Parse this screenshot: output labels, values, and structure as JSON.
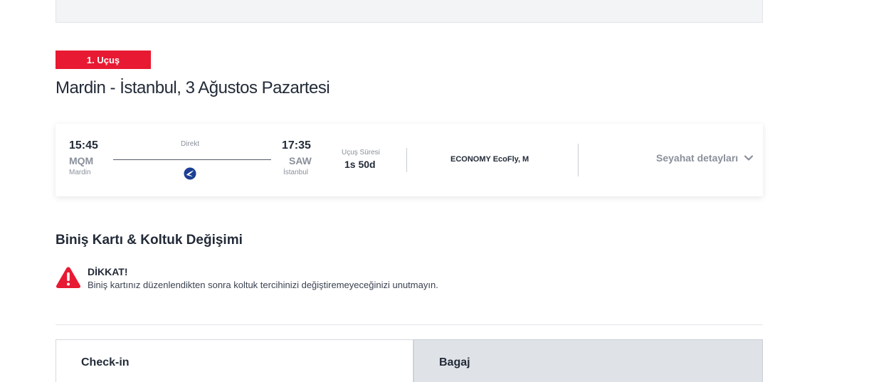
{
  "flight": {
    "badge": "1. Uçuş",
    "title": "Mardin - İstanbul, 3 Ağustos Pazartesi",
    "departure": {
      "time": "15:45",
      "code": "MQM",
      "city": "Mardin"
    },
    "arrival": {
      "time": "17:35",
      "code": "SAW",
      "city": "İstanbul"
    },
    "direct_label": "Direkt",
    "duration_label": "Uçuş Süresi",
    "duration_value": "1s 50d",
    "cabin": "ECONOMY EcoFly, M",
    "details_link": "Seyahat detayları",
    "airline_icon": "turkish-airlines-logo"
  },
  "section": {
    "title": "Biniş Kartı & Koltuk Değişimi",
    "warning": {
      "title": "DİKKAT!",
      "text": "Biniş kartınız düzenlendikten sonra koltuk tercihinizi değiştiremeyeceğinizi unutmayın.",
      "icon": "warning-triangle-icon",
      "color": "#e81932"
    }
  },
  "tabs": [
    {
      "label": "Check-in",
      "active": true
    },
    {
      "label": "Bagaj",
      "active": false
    }
  ],
  "colors": {
    "accent": "#e81932",
    "muted": "#8a909b",
    "text": "#232b38"
  }
}
